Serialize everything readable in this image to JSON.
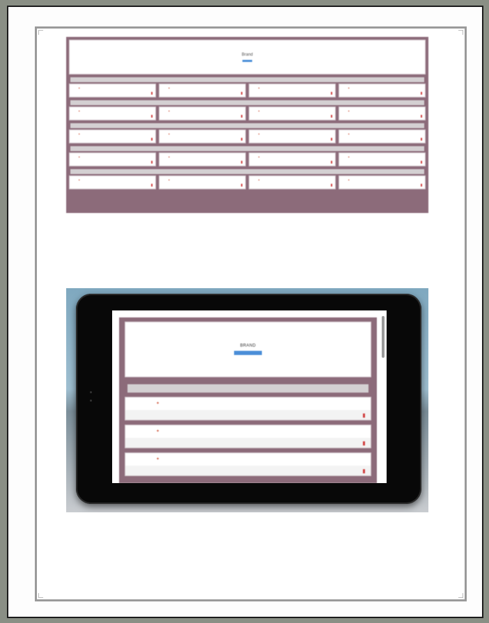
{
  "desktop": {
    "logo": "Brand",
    "subtitle": "",
    "button": "",
    "sections": [
      {
        "label": "",
        "cards": [
          {
            "icon": "pdf-icon"
          },
          {
            "icon": "pdf-icon"
          },
          {
            "icon": "pdf-icon"
          },
          {
            "icon": "pdf-icon"
          }
        ]
      },
      {
        "label": "",
        "cards": [
          {
            "icon": "pdf-icon"
          },
          {
            "icon": "pdf-icon"
          },
          {
            "icon": "pdf-icon"
          },
          {
            "icon": "pdf-icon"
          }
        ]
      },
      {
        "label": "",
        "cards": [
          {
            "icon": "pdf-icon"
          },
          {
            "icon": "pdf-icon"
          },
          {
            "icon": "pdf-icon"
          },
          {
            "icon": "pdf-icon"
          }
        ]
      },
      {
        "label": "",
        "cards": [
          {
            "icon": "pdf-icon"
          },
          {
            "icon": "pdf-icon"
          },
          {
            "icon": "pdf-icon"
          },
          {
            "icon": "pdf-icon"
          }
        ]
      },
      {
        "label": "",
        "cards": [
          {
            "icon": "pdf-icon"
          },
          {
            "icon": "pdf-icon"
          },
          {
            "icon": "pdf-icon"
          },
          {
            "icon": "pdf-icon"
          }
        ]
      }
    ]
  },
  "tablet": {
    "logo": "BRAND",
    "subtitle": "",
    "button": "",
    "section_label": "",
    "cards": [
      {
        "icon": "pdf-icon"
      },
      {
        "icon": "pdf-icon"
      },
      {
        "icon": "pdf-icon"
      }
    ]
  },
  "colors": {
    "page_bg": "#8c6b7a",
    "link": "#4a7fc0",
    "accent": "#d05a40"
  }
}
